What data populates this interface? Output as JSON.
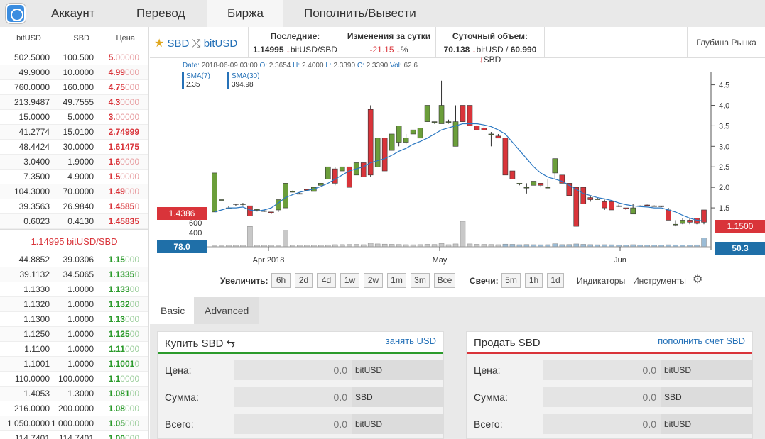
{
  "nav": {
    "tabs": [
      {
        "label": "Аккаунт"
      },
      {
        "label": "Перевод"
      },
      {
        "label": "Биржа"
      },
      {
        "label": "Пополнить/Вывести"
      }
    ]
  },
  "orderbook": {
    "headers": [
      "bitUSD",
      "SBD",
      "Цена"
    ],
    "asks": [
      {
        "a": "502.5000",
        "b": "100.500",
        "p": "5.",
        "t": "00000"
      },
      {
        "a": "49.9000",
        "b": "10.0000",
        "p": "4.99",
        "t": "000"
      },
      {
        "a": "760.0000",
        "b": "160.000",
        "p": "4.75",
        "t": "000"
      },
      {
        "a": "213.9487",
        "b": "49.7555",
        "p": "4.3",
        "t": "0000"
      },
      {
        "a": "15.0000",
        "b": "5.0000",
        "p": "3.",
        "t": "00000"
      },
      {
        "a": "41.2774",
        "b": "15.0100",
        "p": "2.74999",
        "t": ""
      },
      {
        "a": "48.4424",
        "b": "30.0000",
        "p": "1.61475",
        "t": ""
      },
      {
        "a": "3.0400",
        "b": "1.9000",
        "p": "1.6",
        "t": "0000"
      },
      {
        "a": "7.3500",
        "b": "4.9000",
        "p": "1.5",
        "t": "0000"
      },
      {
        "a": "104.3000",
        "b": "70.0000",
        "p": "1.49",
        "t": "000"
      },
      {
        "a": "39.3563",
        "b": "26.9840",
        "p": "1.4585",
        "t": "0"
      },
      {
        "a": "0.6023",
        "b": "0.4130",
        "p": "1.45835",
        "t": ""
      }
    ],
    "last_price": "1.14995 bitUSD/SBD",
    "bids": [
      {
        "a": "44.8852",
        "b": "39.0306",
        "p": "1.15",
        "t": "000"
      },
      {
        "a": "39.1132",
        "b": "34.5065",
        "p": "1.1335",
        "t": "0"
      },
      {
        "a": "1.1330",
        "b": "1.0000",
        "p": "1.133",
        "t": "00"
      },
      {
        "a": "1.1320",
        "b": "1.0000",
        "p": "1.132",
        "t": "00"
      },
      {
        "a": "1.1300",
        "b": "1.0000",
        "p": "1.13",
        "t": "000"
      },
      {
        "a": "1.1250",
        "b": "1.0000",
        "p": "1.125",
        "t": "00"
      },
      {
        "a": "1.1100",
        "b": "1.0000",
        "p": "1.11",
        "t": "000"
      },
      {
        "a": "1.1001",
        "b": "1.0000",
        "p": "1.1001",
        "t": "0"
      },
      {
        "a": "110.0000",
        "b": "100.0000",
        "p": "1.1",
        "t": "0000"
      },
      {
        "a": "1.4053",
        "b": "1.3000",
        "p": "1.081",
        "t": "00"
      },
      {
        "a": "216.0000",
        "b": "200.0000",
        "p": "1.08",
        "t": "000"
      },
      {
        "a": "1 050.0000",
        "b": "1 000.0000",
        "p": "1.05",
        "t": "000"
      },
      {
        "a": "114.7401",
        "b": "114.7401",
        "p": "1.00",
        "t": "000"
      }
    ]
  },
  "market": {
    "base": "SBD",
    "quote": "bitUSD",
    "last_title": "Последние:",
    "last_value": "1.14995",
    "last_arrow": "↓",
    "last_unit": "bitUSD/SBD",
    "change_title": "Изменения за сутки",
    "change_value": "-21.15",
    "change_arrow": "↓",
    "change_unit": "%",
    "volume_title": "Суточный объем:",
    "volume_v1": "70.138",
    "volume_a1": "↓",
    "volume_u1": "bitUSD",
    "volume_sep": "/",
    "volume_v2": "60.990",
    "volume_a2": "↓",
    "volume_u2": "SBD",
    "depth_label": "Глубина Рынка"
  },
  "chart_info": {
    "date_label": "Date:",
    "date_value": "2018-06-09 03:00",
    "o_label": "O:",
    "o_value": "2.3654",
    "h_label": "H:",
    "h_value": "2.4000",
    "l_label": "L:",
    "l_value": "2.3390",
    "c_label": "C:",
    "c_value": "2.3390",
    "vol_label": "Vol:",
    "vol_value": "62.6",
    "sma7_label": "SMA(7)",
    "sma7_value": "2.35",
    "sma30_label": "SMA(30)",
    "sma30_value": "394.98",
    "left_price_tag": "1.4386",
    "right_price_tag": "1.1500",
    "left_vol_tag": "78.0",
    "right_vol_tag": "50.3"
  },
  "chart_data": {
    "type": "candlestick",
    "title": "",
    "price_axis": {
      "ticks": [
        "1.5",
        "2.0",
        "2.5",
        "3.0",
        "3.5",
        "4.0",
        "4.5"
      ],
      "range": [
        1.0,
        4.7
      ]
    },
    "volume_axis": {
      "ticks": [
        "400",
        "600"
      ]
    },
    "x_labels": [
      "Apr 2018",
      "May",
      "Jun"
    ],
    "candles": [
      {
        "o": 1.4,
        "h": 2.35,
        "l": 1.4,
        "c": 2.35,
        "v": 10
      },
      {
        "o": 1.7,
        "h": 1.7,
        "l": 1.7,
        "c": 1.7,
        "v": 5
      },
      {
        "o": 1.5,
        "h": 1.55,
        "l": 1.48,
        "c": 1.5,
        "v": 6
      },
      {
        "o": 1.6,
        "h": 1.6,
        "l": 1.55,
        "c": 1.6,
        "v": 4
      },
      {
        "o": 1.58,
        "h": 1.62,
        "l": 1.56,
        "c": 1.6,
        "v": 5
      },
      {
        "o": 1.55,
        "h": 1.55,
        "l": 1.3,
        "c": 1.3,
        "v": 520
      },
      {
        "o": 1.45,
        "h": 1.48,
        "l": 1.43,
        "c": 1.46,
        "v": 10
      },
      {
        "o": 1.42,
        "h": 1.45,
        "l": 1.4,
        "c": 1.43,
        "v": 8
      },
      {
        "o": 1.4,
        "h": 1.4,
        "l": 1.35,
        "c": 1.38,
        "v": 6
      },
      {
        "o": 1.45,
        "h": 1.7,
        "l": 1.4,
        "c": 1.7,
        "v": 7
      },
      {
        "o": 1.5,
        "h": 2.1,
        "l": 1.5,
        "c": 2.1,
        "v": 420
      },
      {
        "o": 1.9,
        "h": 1.92,
        "l": 1.88,
        "c": 1.9,
        "v": 6
      },
      {
        "o": 1.85,
        "h": 1.87,
        "l": 1.83,
        "c": 1.85,
        "v": 5
      },
      {
        "o": 1.95,
        "h": 1.95,
        "l": 1.92,
        "c": 1.93,
        "v": 8
      },
      {
        "o": 1.9,
        "h": 2.0,
        "l": 1.9,
        "c": 2.0,
        "v": 10
      },
      {
        "o": 2.05,
        "h": 2.1,
        "l": 2.05,
        "c": 2.1,
        "v": 12
      },
      {
        "o": 2.2,
        "h": 2.5,
        "l": 2.2,
        "c": 2.5,
        "v": 15
      },
      {
        "o": 2.45,
        "h": 2.5,
        "l": 2.05,
        "c": 2.1,
        "v": 20
      },
      {
        "o": 2.4,
        "h": 2.5,
        "l": 2.4,
        "c": 2.5,
        "v": 22
      },
      {
        "o": 2.5,
        "h": 2.5,
        "l": 2.0,
        "c": 2.0,
        "v": 25
      },
      {
        "o": 2.3,
        "h": 2.6,
        "l": 2.3,
        "c": 2.6,
        "v": 28
      },
      {
        "o": 2.6,
        "h": 2.6,
        "l": 2.25,
        "c": 2.25,
        "v": 20
      },
      {
        "o": 3.9,
        "h": 4.0,
        "l": 2.25,
        "c": 2.3,
        "v": 60
      },
      {
        "o": 2.5,
        "h": 3.2,
        "l": 2.5,
        "c": 3.2,
        "v": 40
      },
      {
        "o": 3.2,
        "h": 3.2,
        "l": 2.4,
        "c": 2.4,
        "v": 35
      },
      {
        "o": 2.9,
        "h": 3.3,
        "l": 2.9,
        "c": 3.3,
        "v": 30
      },
      {
        "o": 3.1,
        "h": 3.5,
        "l": 3.0,
        "c": 3.5,
        "v": 25
      },
      {
        "o": 3.1,
        "h": 3.3,
        "l": 3.05,
        "c": 3.2,
        "v": 20
      },
      {
        "o": 3.3,
        "h": 3.4,
        "l": 3.3,
        "c": 3.4,
        "v": 18
      },
      {
        "o": 3.2,
        "h": 3.45,
        "l": 3.2,
        "c": 3.45,
        "v": 22
      },
      {
        "o": 3.6,
        "h": 4.0,
        "l": 3.6,
        "c": 4.0,
        "v": 30
      },
      {
        "o": 3.6,
        "h": 3.6,
        "l": 3.55,
        "c": 3.6,
        "v": 25
      },
      {
        "o": 3.55,
        "h": 4.6,
        "l": 3.55,
        "c": 4.0,
        "v": 50
      },
      {
        "o": 3.6,
        "h": 3.65,
        "l": 3.55,
        "c": 3.6,
        "v": 20
      },
      {
        "o": 3.0,
        "h": 4.0,
        "l": 3.0,
        "c": 3.6,
        "v": 40
      },
      {
        "o": 4.0,
        "h": 4.0,
        "l": 3.6,
        "c": 3.6,
        "v": 680
      },
      {
        "o": 4.0,
        "h": 4.0,
        "l": 3.5,
        "c": 3.5,
        "v": 40
      },
      {
        "o": 3.5,
        "h": 3.55,
        "l": 3.4,
        "c": 3.4,
        "v": 30
      },
      {
        "o": 3.45,
        "h": 3.5,
        "l": 3.4,
        "c": 3.4,
        "v": 28
      },
      {
        "o": 3.3,
        "h": 3.35,
        "l": 3.0,
        "c": 3.3,
        "v": 25
      },
      {
        "o": 3.25,
        "h": 3.3,
        "l": 3.2,
        "c": 3.2,
        "v": 20
      },
      {
        "o": 3.2,
        "h": 3.2,
        "l": 2.3,
        "c": 2.3,
        "v": 35
      },
      {
        "o": 2.4,
        "h": 2.4,
        "l": 2.2,
        "c": 2.2,
        "v": 30
      },
      {
        "o": 2.1,
        "h": 2.1,
        "l": 2.05,
        "c": 2.1,
        "v": 20
      },
      {
        "o": 2.0,
        "h": 2.1,
        "l": 1.85,
        "c": 2.0,
        "v": 25
      },
      {
        "o": 2.05,
        "h": 2.15,
        "l": 2.05,
        "c": 2.15,
        "v": 20
      },
      {
        "o": 2.1,
        "h": 2.1,
        "l": 2.0,
        "c": 2.05,
        "v": 18
      },
      {
        "o": 2.0,
        "h": 2.2,
        "l": 2.0,
        "c": 2.0,
        "v": 20
      },
      {
        "o": 2.35,
        "h": 2.7,
        "l": 2.2,
        "c": 2.7,
        "v": 45
      },
      {
        "o": 2.3,
        "h": 2.3,
        "l": 2.1,
        "c": 2.1,
        "v": 22
      },
      {
        "o": 2.1,
        "h": 2.1,
        "l": 1.8,
        "c": 1.8,
        "v": 25
      },
      {
        "o": 2.0,
        "h": 2.0,
        "l": 1.05,
        "c": 1.05,
        "v": 40
      },
      {
        "o": 2.0,
        "h": 2.0,
        "l": 1.6,
        "c": 1.6,
        "v": 30
      },
      {
        "o": 1.75,
        "h": 1.8,
        "l": 1.65,
        "c": 1.7,
        "v": 22
      },
      {
        "o": 1.7,
        "h": 1.75,
        "l": 1.7,
        "c": 1.72,
        "v": 18
      },
      {
        "o": 1.65,
        "h": 1.7,
        "l": 1.45,
        "c": 1.5,
        "v": 20
      },
      {
        "o": 1.65,
        "h": 1.65,
        "l": 1.45,
        "c": 1.45,
        "v": 18
      },
      {
        "o": 1.55,
        "h": 1.58,
        "l": 1.52,
        "c": 1.55,
        "v": 15
      },
      {
        "o": 1.5,
        "h": 1.5,
        "l": 1.45,
        "c": 1.48,
        "v": 12
      },
      {
        "o": 1.35,
        "h": 1.6,
        "l": 1.35,
        "c": 1.5,
        "v": 20
      },
      {
        "o": 1.55,
        "h": 1.56,
        "l": 1.53,
        "c": 1.55,
        "v": 15
      },
      {
        "o": 1.57,
        "h": 1.58,
        "l": 1.55,
        "c": 1.56,
        "v": 12
      },
      {
        "o": 1.55,
        "h": 1.56,
        "l": 1.53,
        "c": 1.55,
        "v": 14
      },
      {
        "o": 1.55,
        "h": 1.55,
        "l": 1.52,
        "c": 1.53,
        "v": 12
      },
      {
        "o": 1.45,
        "h": 1.5,
        "l": 1.2,
        "c": 1.2,
        "v": 18
      },
      {
        "o": 1.1,
        "h": 1.2,
        "l": 1.05,
        "c": 1.1,
        "v": 15
      },
      {
        "o": 1.12,
        "h": 1.25,
        "l": 1.1,
        "c": 1.2,
        "v": 14
      },
      {
        "o": 1.2,
        "h": 1.25,
        "l": 1.1,
        "c": 1.15,
        "v": 12
      },
      {
        "o": 1.25,
        "h": 1.25,
        "l": 1.1,
        "c": 1.12,
        "v": 15
      },
      {
        "o": 1.45,
        "h": 1.45,
        "l": 1.1,
        "c": 1.15,
        "v": 200
      }
    ],
    "sma7": [
      1.4,
      1.45,
      1.5,
      1.5,
      1.52,
      1.45,
      1.42,
      1.45,
      1.5,
      1.62,
      1.75,
      1.82,
      1.88,
      1.92,
      1.96,
      2.02,
      2.1,
      2.2,
      2.3,
      2.4,
      2.45,
      2.5,
      2.6,
      2.65,
      2.7,
      2.78,
      2.88,
      2.95,
      3.05,
      3.12,
      3.2,
      3.3,
      3.4,
      3.45,
      3.5,
      3.55,
      3.55,
      3.55,
      3.52,
      3.48,
      3.4,
      3.3,
      3.1,
      2.9,
      2.7,
      2.5,
      2.35,
      2.25,
      2.2,
      2.15,
      2.05,
      1.95,
      1.85,
      1.8,
      1.75,
      1.72,
      1.68,
      1.62,
      1.58,
      1.55,
      1.53,
      1.52,
      1.5,
      1.5,
      1.45,
      1.4,
      1.32,
      1.25,
      1.2,
      1.18
    ]
  },
  "zoom": {
    "label": "Увеличить:",
    "buttons": [
      "6h",
      "2d",
      "4d",
      "1w",
      "2w",
      "1m",
      "3m",
      "Все"
    ],
    "candles_label": "Свечи:",
    "candle_buttons": [
      "5m",
      "1h",
      "1d"
    ],
    "indicators": "Индикаторы",
    "tools": "Инструменты"
  },
  "lower_tabs": [
    "Basic",
    "Advanced"
  ],
  "buy": {
    "title": "Купить SBD",
    "title_icon": "⇆",
    "link": "занять USD",
    "rows": [
      {
        "label": "Цена:",
        "value": "0.0",
        "unit": "bitUSD"
      },
      {
        "label": "Сумма:",
        "value": "0.0",
        "unit": "SBD"
      },
      {
        "label": "Всего:",
        "value": "0.0",
        "unit": "bitUSD"
      }
    ]
  },
  "sell": {
    "title": "Продать SBD",
    "link": "пополнить счет SBD",
    "rows": [
      {
        "label": "Цена:",
        "value": "0.0",
        "unit": "bitUSD"
      },
      {
        "label": "Сумма:",
        "value": "0.0",
        "unit": "SBD"
      },
      {
        "label": "Всего:",
        "value": "0.0",
        "unit": "bitUSD"
      }
    ]
  },
  "colors": {
    "up": "#6b9e3a",
    "down": "#d9343a",
    "sma": "#2b78c2",
    "volume": "#c8c8c8"
  }
}
